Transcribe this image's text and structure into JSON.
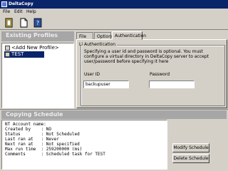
{
  "window": {
    "title": "DeltaCopy"
  },
  "menu": [
    "File",
    "Edit",
    "Help"
  ],
  "toolbar": [
    {
      "name": "new-profile-button",
      "icon": "document-icon"
    },
    {
      "name": "delete-profile-button",
      "icon": "page-icon"
    },
    {
      "name": "help-button",
      "icon": "help-icon"
    }
  ],
  "profiles": {
    "header": "Existing Profiles",
    "items": [
      "<Add New Profile>",
      "TEST"
    ],
    "selected_index": 1
  },
  "tabs": [
    "File List",
    "Options",
    "Authentication"
  ],
  "active_tab": 2,
  "auth": {
    "group_label": "Authentication",
    "description": "Specifying a user id and password is optional. You must configure a virtual directory in DeltaCopy server to accept user/password before specifying it here",
    "user_id_label": "User ID",
    "user_id_value": "backupuser",
    "password_label": "Password",
    "password_value": ""
  },
  "schedule": {
    "header": "Copying Schedule",
    "lines": [
      "NT Account name:",
      "Created by    : NO",
      "Status        : Not Scheduled",
      "Last ran at   : Never",
      "Next ran at   : Not specified",
      "Max run time  : 259200000 (ms)",
      "Comments      : Scheduled task for TEST"
    ],
    "modify_label": "Modify Schedule",
    "delete_label": "Delete Schedule"
  },
  "colors": {
    "titlebar": "#0a246a",
    "selection": "#0a246a",
    "header": "#a6a6a6",
    "face": "#d4d0c8"
  }
}
